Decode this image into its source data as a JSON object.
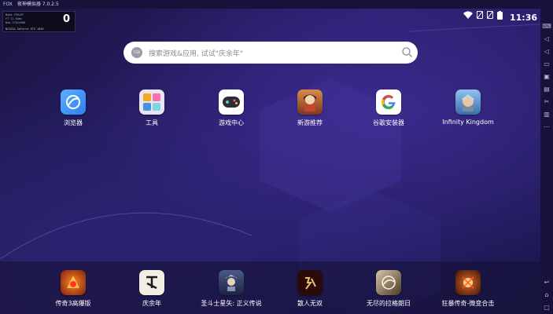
{
  "titlebar": {
    "brand": "FOX",
    "title": "夜神模拟器 7.0.2.5"
  },
  "stats": {
    "lines": [
      "Mode CPU+FF",
      "FT 11.04ms",
      "Req 1762x906"
    ],
    "fps": "0",
    "gpu": "NVIDIA GeForce GTX 1650"
  },
  "status": {
    "clock": "11:36"
  },
  "search": {
    "placeholder": "搜索游戏&应用, 试试\"庆余年\"",
    "logo": "FOX"
  },
  "apps": [
    {
      "label": "浏览器"
    },
    {
      "label": "工具"
    },
    {
      "label": "游戏中心"
    },
    {
      "label": "新游推荐"
    },
    {
      "label": "谷歌安装器"
    },
    {
      "label": "Infinity Kingdom"
    }
  ],
  "dock": [
    {
      "label": "传奇3高爆版"
    },
    {
      "label": "庆余年"
    },
    {
      "label": "圣斗士星矢: 正义传说"
    },
    {
      "label": "散人无双"
    },
    {
      "label": "无尽的拉格朗日"
    },
    {
      "label": "狂暴传奇-微变合击"
    }
  ]
}
